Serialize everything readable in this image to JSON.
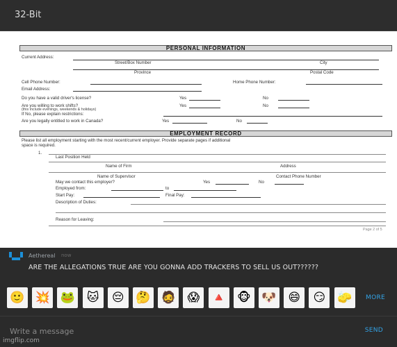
{
  "window": {
    "title": "32-Bit"
  },
  "form": {
    "personal_header": "PERSONAL INFORMATION",
    "current_address": "Current Address:",
    "street_box": "Street/Box Number",
    "city": "City",
    "province": "Province",
    "postal_code": "Postal Code",
    "cell_phone": "Cell Phone Number:",
    "home_phone": "Home Phone Number:",
    "email": "Email Address:",
    "drivers_license": "Do you have a valid driver's license?",
    "yes": "Yes",
    "no": "No",
    "work_shifts": "Are you willing to work shifts?",
    "shifts_note": "(this include evenings, weekends & holidays)",
    "explain": "If No, please explain restrictions:",
    "entitled": "Are you legally entitled to work in Canada?",
    "employment_header": "EMPLOYMENT RECORD",
    "list_instructions": "Please list all employment starting with the most recent/current employer. Provide separate pages if additional",
    "space_required": "space is required.",
    "item_number": "1.",
    "last_position": "Last Position Held",
    "name_of_firm": "Name of Firm",
    "address": "Address",
    "name_of_supervisor": "Name of Supervisor",
    "contact_phone": "Contact Phone Number",
    "may_we_contact": "May we contact this employer?",
    "employed_from": "Employed from:",
    "to": "to",
    "start_pay": "Start Pay:",
    "final_pay": "Final Pay:",
    "duties": "Description of Duties:",
    "reason": "Reason for Leaving:",
    "page": "Page 2 of 5"
  },
  "chat": {
    "author": "Aethereal",
    "time": "now",
    "message": "ARE THE ALLEGATIONS TRUE ARE YOU GONNA ADD TRACKERS TO SELL US OUT??????",
    "more_label": "MORE",
    "input_placeholder": "Write a message",
    "send_label": "SEND",
    "emojis": [
      {
        "name": "happy-rage-face-emoji",
        "glyph": "🙂"
      },
      {
        "name": "explosion-emoji",
        "glyph": "💥"
      },
      {
        "name": "pepe-frog-emoji",
        "glyph": "🐸"
      },
      {
        "name": "cat-emoji",
        "glyph": "🐱"
      },
      {
        "name": "sad-rage-face-emoji",
        "glyph": "😔"
      },
      {
        "name": "thinking-rage-face-emoji",
        "glyph": "🤔"
      },
      {
        "name": "jesus-emoji",
        "glyph": "🧔"
      },
      {
        "name": "screaming-rage-face-emoji",
        "glyph": "😱"
      },
      {
        "name": "illuminati-pyramid-emoji",
        "glyph": "🔺"
      },
      {
        "name": "monkey-emoji",
        "glyph": "🐵"
      },
      {
        "name": "doge-emoji",
        "glyph": "🐶"
      },
      {
        "name": "troll-face-emoji",
        "glyph": "😄"
      },
      {
        "name": "smug-rage-face-emoji",
        "glyph": "😏"
      },
      {
        "name": "spongebob-emoji",
        "glyph": "🧽"
      }
    ]
  },
  "watermark": "imgflip.com",
  "colors": {
    "accent": "#33a3e6",
    "background": "#2b2b2b",
    "text": "#e6e6e6"
  }
}
